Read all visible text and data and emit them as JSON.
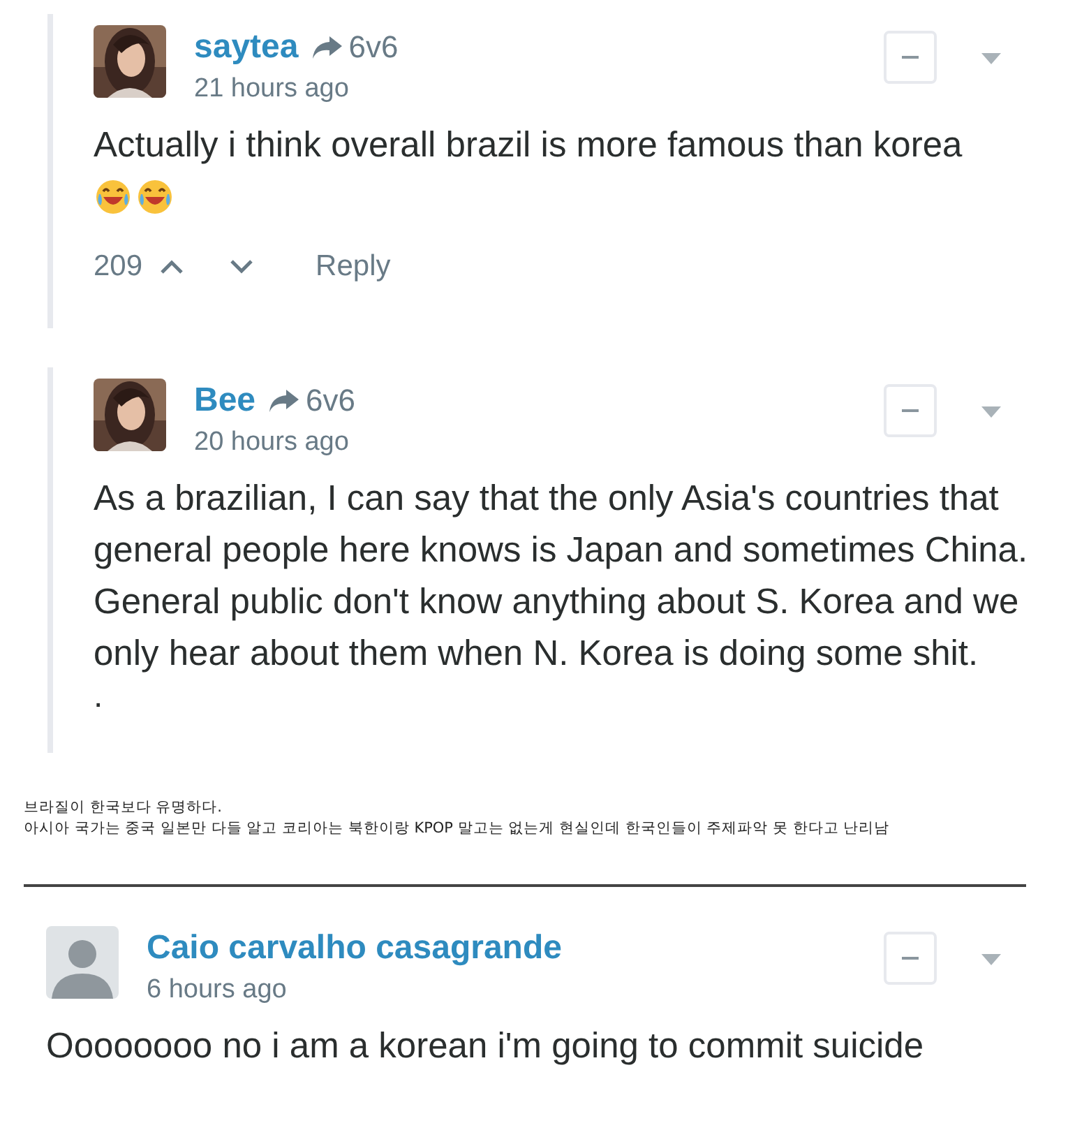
{
  "comments": [
    {
      "author": "saytea",
      "reply_to": "6v6",
      "time": "21 hours ago",
      "text": "Actually i think overall brazil is more famous than korea",
      "reactions": [
        {
          "kind": "laughing"
        },
        {
          "kind": "laughing"
        }
      ],
      "votes": "209",
      "reply": "Reply",
      "threaded": true
    },
    {
      "author": "Bee",
      "reply_to": "6v6",
      "time": "20 hours ago",
      "text": "As a brazilian, I can say that the only Asia's countries that general people here knows is Japan and sometimes China. General public don't know anything about S. Korea and we only hear about them when N. Korea is doing some shit.",
      "trailing": ".",
      "threaded": true
    }
  ],
  "caption": [
    "브라질이 한국보다 유명하다.",
    "아시아 국가는 중국 일본만 다들 알고 코리아는 북한이랑 KPOP 말고는 없는게 현실인데 한국인들이 주제파악 못 한다고 난리남"
  ],
  "last_comment": {
    "author": "Caio carvalho casagrande",
    "time": "6 hours ago",
    "avatar": {
      "kind": "silhouette"
    },
    "text": "Oooooooo no i am a korean i'm going to commit suicide",
    "threaded": false
  }
}
